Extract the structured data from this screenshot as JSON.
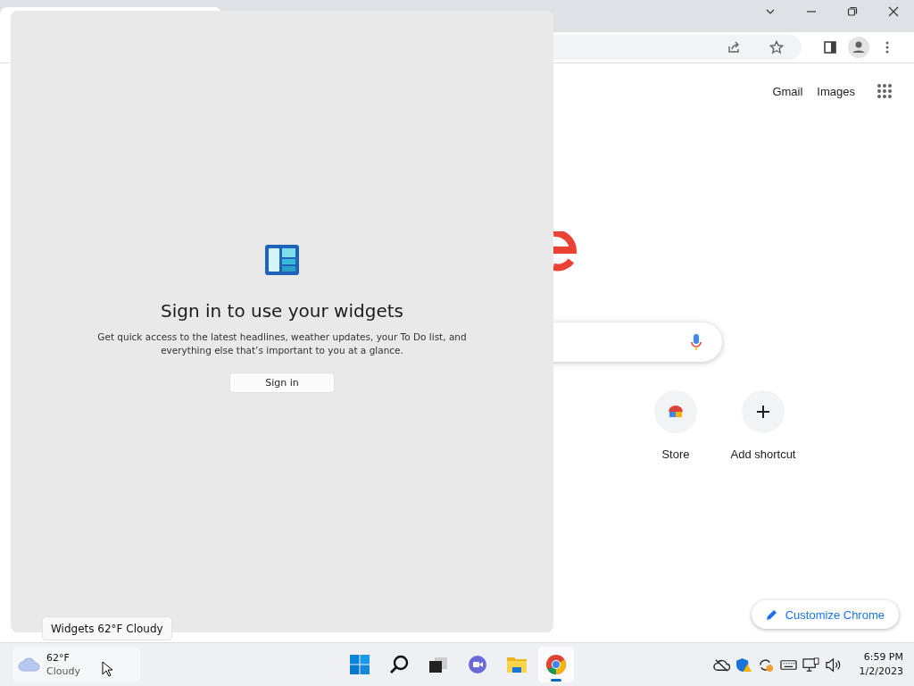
{
  "header_links": [
    "Gmail",
    "Images"
  ],
  "shortcuts": [
    {
      "label": "Store",
      "kind": "store"
    },
    {
      "label": "Add shortcut",
      "kind": "add"
    }
  ],
  "customize_button": "Customize Chrome",
  "widgets_panel": {
    "title": "Sign in to use your widgets",
    "description": "Get quick access to the latest headlines, weather updates, your To Do list, and everything else that’s important to you at a glance.",
    "button": "Sign in"
  },
  "tooltip": "Widgets 62°F Cloudy",
  "taskbar": {
    "weather": {
      "temperature": "62°F",
      "condition": "Cloudy"
    },
    "apps": [
      {
        "kind": "start",
        "active": false
      },
      {
        "kind": "search",
        "active": false
      },
      {
        "kind": "taskview",
        "active": false
      },
      {
        "kind": "chat",
        "active": false
      },
      {
        "kind": "files",
        "active": false
      },
      {
        "kind": "chrome",
        "active": true
      }
    ],
    "clock": {
      "time": "6:59 PM",
      "date": "1/2/2023"
    }
  }
}
